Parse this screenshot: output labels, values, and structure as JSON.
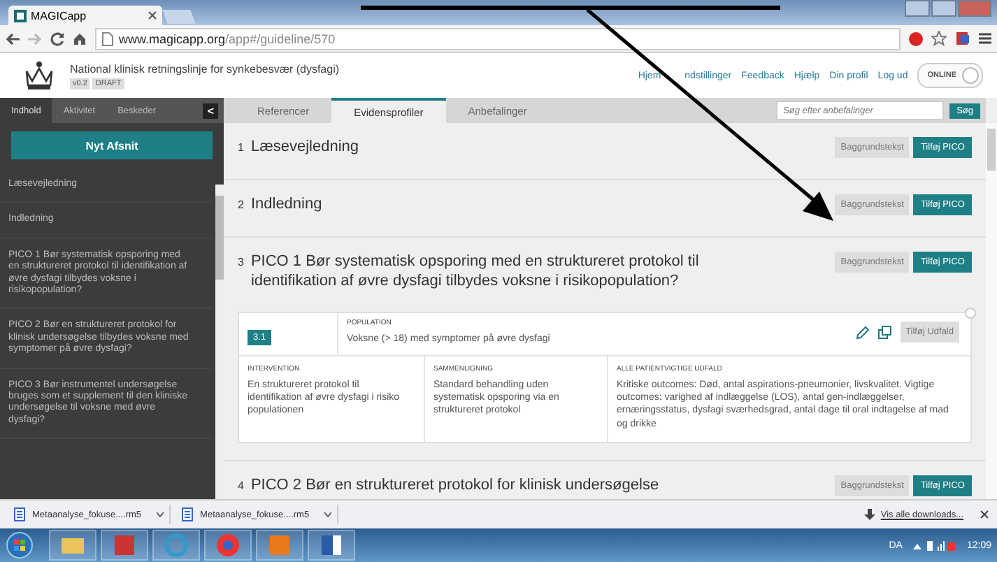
{
  "browser": {
    "tab_title": "MAGICapp",
    "url_host": "www.magicapp.org",
    "url_path": "/app#/guideline/570"
  },
  "header": {
    "title": "National klinisk retningslinje for synkebesvær (dysfagi)",
    "version": "v0.2",
    "status": "DRAFT",
    "nav": [
      "Hjem",
      "ndstillinger",
      "Feedback",
      "Hjælp",
      "Din profil",
      "Log ud"
    ],
    "online": {
      "label": "ONLINE",
      "on": true
    }
  },
  "sidebar": {
    "tabs": [
      {
        "label": "Indhold",
        "selected": true
      },
      {
        "label": "Aktivitet",
        "selected": false
      },
      {
        "label": "Beskeder",
        "selected": false
      }
    ],
    "collapse": "<",
    "new_button": "Nyt Afsnit",
    "items": [
      "Læsevejledning",
      "Indledning",
      "PICO 1 Bør systematisk opsporing med en struktureret protokol til identifikation af øvre dysfagi tilbydes voksne i risikopopulation?",
      "PICO 2 Bør en struktureret protokol for klinisk undersøgelse tilbydes voksne med symptomer på øvre dysfagi?",
      "PICO 3 Bør instrumentel undersøgelse bruges som et supplement til den kliniske undersøgelse til voksne med øvre dysfagi?"
    ]
  },
  "main": {
    "tabs": [
      {
        "label": "Referencer",
        "selected": false
      },
      {
        "label": "Evidensprofiler",
        "selected": true
      },
      {
        "label": "Anbefalinger",
        "selected": false
      }
    ],
    "search": {
      "placeholder": "Søg efter anbefalinger",
      "button": "Søg"
    },
    "sections": [
      {
        "number": "1",
        "title": "Læsevejledning",
        "buttons": [
          "Baggrundstekst",
          "Tilføj PICO"
        ]
      },
      {
        "number": "2",
        "title": "Indledning",
        "buttons": [
          "Baggrundstekst",
          "Tilføj PICO"
        ]
      },
      {
        "number": "3",
        "title": "PICO 1 Bør systematisk opsporing med en struktureret protokol til identifikation af øvre dysfagi tilbydes voksne i risikopopulation?",
        "buttons": [
          "Baggrundstekst",
          "Tilføj PICO"
        ],
        "pico": {
          "badge": "3.1",
          "population_label": "POPULATION",
          "population": "Voksne (> 18) med symptomer på øvre dysfagi",
          "action": "Tilføj Udfald",
          "columns": [
            {
              "label": "INTERVENTION",
              "text": "En struktureret protokol til identifikation af øvre dysfagi i risiko populationen"
            },
            {
              "label": "SAMMENLIGNING",
              "text": "Standard behandling uden systematisk opsporing via en struktureret protokol"
            },
            {
              "label": "ALLE PATIENTVIGTIGE UDFALD",
              "text": "Kritiske outcomes: Død, antal aspirations-pneumonier, livskvalitet. Vigtige outcomes: varighed af indlæggelse (LOS), antal gen-indlæggelser, ernæringsstatus, dysfagi sværhedsgrad, antal dage til oral indtagelse af mad og drikke"
            }
          ]
        }
      },
      {
        "number": "4",
        "title": "PICO 2 Bør en struktureret protokol for klinisk undersøgelse",
        "buttons": [
          "Baggrundstekst",
          "Tilføj PICO"
        ]
      }
    ]
  },
  "downloads": {
    "items": [
      "Metaanalyse_fokuse....rm5",
      "Metaanalyse_fokuse....rm5"
    ],
    "link": "Vis alle downloads..."
  },
  "taskbar": {
    "language": "DA",
    "time": "12:09"
  }
}
